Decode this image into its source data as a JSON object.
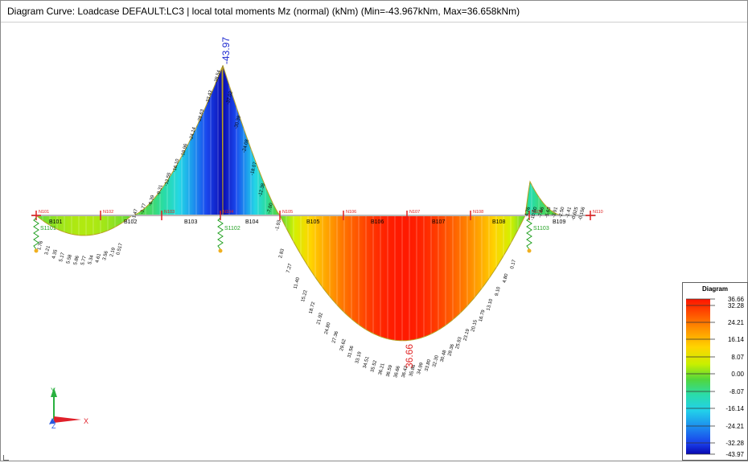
{
  "window": {
    "title": "Diagram Curve: Loadcase DEFAULT:LC3 | local total moments Mz (normal) (kNm) (Min=-43.967kNm, Max=36.658kNm)"
  },
  "extremes": {
    "min_label": "-43.97",
    "max_label": "36.66"
  },
  "nodes": [
    "N101",
    "N102",
    "N103",
    "N104",
    "N105",
    "N106",
    "N107",
    "N108",
    "N109",
    "N110"
  ],
  "beams": [
    "B101",
    "B102",
    "B103",
    "B104",
    "B105",
    "B106",
    "B107",
    "B108",
    "B109"
  ],
  "supports": [
    "S1101",
    "S1102",
    "S1103"
  ],
  "diagram_values": {
    "span1": [
      "1.76",
      "3.21",
      "4.35",
      "5.17",
      "5.58",
      "5.86",
      "5.77",
      "5.34",
      "4.61",
      "3.56",
      "2.19",
      "0.517"
    ],
    "span2_rise": [
      "-1.47",
      "-3.77",
      "-6.39",
      "-9.31",
      "-12.55",
      "-16.10",
      "-19.96",
      "-24.14",
      "-28.63",
      "-33.43",
      "-38.54"
    ],
    "span3_fall": [
      "-37.02",
      "-30.39",
      "-24.08",
      "-18.07",
      "-12.38",
      "-7.00",
      "-1.93"
    ],
    "span4": [
      "2.83",
      "7.27",
      "11.40",
      "15.22",
      "18.72",
      "21.92",
      "24.80",
      "27.36",
      "29.62",
      "31.56",
      "33.19",
      "34.51",
      "35.52",
      "36.21",
      "36.59",
      "36.66",
      "36.42",
      "35.86",
      "34.99",
      "33.80",
      "32.30",
      "30.48",
      "28.36",
      "25.93",
      "23.19",
      "20.15",
      "16.79",
      "13.10",
      "9.10",
      "4.80",
      "0.17"
    ],
    "span5": [
      "4.76",
      "-10.00",
      "-7.66",
      "-5.63",
      "-3.91",
      "-2.50",
      "-1.41",
      "-0.625",
      "-0.156"
    ]
  },
  "legend": {
    "title": "Diagram",
    "values": [
      "36.66",
      "32.28",
      "24.21",
      "16.14",
      "8.07",
      "0.00",
      "-8.07",
      "-16.14",
      "-24.21",
      "-32.28",
      "-43.97"
    ],
    "colors": [
      "#ff1a00",
      "#ff5a00",
      "#ff9a00",
      "#ffd400",
      "#d8f000",
      "#55d640",
      "#28dca0",
      "#24d6e6",
      "#1c90ee",
      "#1a48ee",
      "#0a0ab0"
    ]
  },
  "axes": {
    "x": "X",
    "y": "Y",
    "z": "Z"
  },
  "colors": {
    "axis_x": "#e0202a",
    "axis_y": "#2ab040",
    "axis_z": "#2a5ae0",
    "node_mark": "#e02020",
    "support": "#20a020",
    "beam": "#a0a0a0"
  }
}
